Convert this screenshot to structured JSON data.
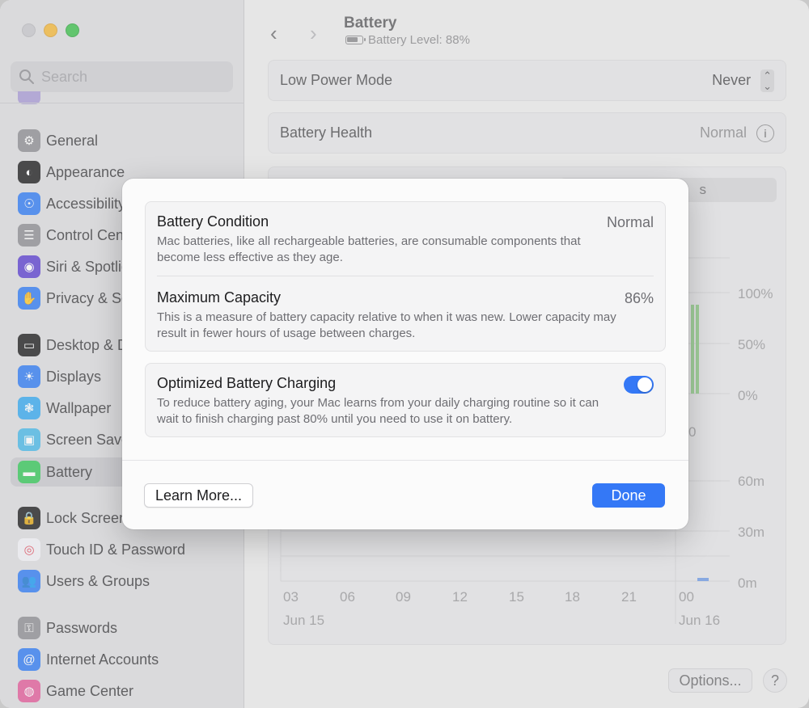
{
  "sidebar": {
    "search_placeholder": "Search",
    "items": [
      {
        "label": "General",
        "icon": "gear-icon",
        "color": "#8e8e93",
        "glyph": "⚙"
      },
      {
        "label": "Appearance",
        "icon": "appearance-icon",
        "color": "#1c1c1e",
        "glyph": "◐"
      },
      {
        "label": "Accessibility",
        "icon": "accessibility-icon",
        "color": "#2f7bf5",
        "glyph": "☉"
      },
      {
        "label": "Control Centre",
        "icon": "control-centre-icon",
        "color": "#8e8e93",
        "glyph": "☰"
      },
      {
        "label": "Siri & Spotlight",
        "icon": "siri-icon",
        "color": "#5b3fd1",
        "glyph": "◉"
      },
      {
        "label": "Privacy & Security",
        "icon": "hand-icon",
        "color": "#2f7bf5",
        "glyph": "✋"
      },
      {
        "label": "Desktop & Dock",
        "icon": "desktop-icon",
        "color": "#1c1c1e",
        "glyph": "▭"
      },
      {
        "label": "Displays",
        "icon": "sun-icon",
        "color": "#2f7bf5",
        "glyph": "☀"
      },
      {
        "label": "Wallpaper",
        "icon": "flower-icon",
        "color": "#35a8f0",
        "glyph": "❃"
      },
      {
        "label": "Screen Saver",
        "icon": "screen-saver-icon",
        "color": "#48b9e8",
        "glyph": "▣"
      },
      {
        "label": "Battery",
        "icon": "battery-icon",
        "color": "#34c759",
        "glyph": "▬"
      },
      {
        "label": "Lock Screen",
        "icon": "lock-icon",
        "color": "#1c1c1e",
        "glyph": "🔒"
      },
      {
        "label": "Touch ID & Password",
        "icon": "fingerprint-icon",
        "color": "#f2f2f7",
        "glyph": "◎"
      },
      {
        "label": "Users & Groups",
        "icon": "users-icon",
        "color": "#2f7bf5",
        "glyph": "👥"
      },
      {
        "label": "Passwords",
        "icon": "key-icon",
        "color": "#8e8e93",
        "glyph": "⚿"
      },
      {
        "label": "Internet Accounts",
        "icon": "at-icon",
        "color": "#2f7bf5",
        "glyph": "@"
      },
      {
        "label": "Game Center",
        "icon": "game-center-icon",
        "color": "#e35b9a",
        "glyph": "◍"
      }
    ]
  },
  "header": {
    "title": "Battery",
    "subtitle": "Battery Level: 88%"
  },
  "low_power": {
    "label": "Low Power Mode",
    "value": "Never"
  },
  "health": {
    "label": "Battery Health",
    "value": "Normal"
  },
  "chart": {
    "segment_peek": "s",
    "y_labels_top": [
      "100%",
      "50%",
      "0%"
    ],
    "y_labels_bottom": [
      "60m",
      "30m",
      "0m"
    ],
    "x_peek_label": "0",
    "x_labels": [
      "03",
      "06",
      "09",
      "12",
      "15",
      "18",
      "21",
      "00"
    ],
    "date_labels": [
      "Jun 15",
      "Jun 16"
    ]
  },
  "buttons": {
    "options": "Options...",
    "help": "?"
  },
  "modal": {
    "condition": {
      "title": "Battery Condition",
      "value": "Normal",
      "desc": "Mac batteries, like all rechargeable batteries, are consumable components that become less effective as they age."
    },
    "capacity": {
      "title": "Maximum Capacity",
      "value": "86%",
      "desc": "This is a measure of battery capacity relative to when it was new. Lower capacity may result in fewer hours of usage between charges."
    },
    "optimized": {
      "title": "Optimized Battery Charging",
      "desc": "To reduce battery aging, your Mac learns from your daily charging routine so it can wait to finish charging past 80% until you need to use it on battery."
    },
    "learn_more": "Learn More...",
    "done": "Done"
  }
}
